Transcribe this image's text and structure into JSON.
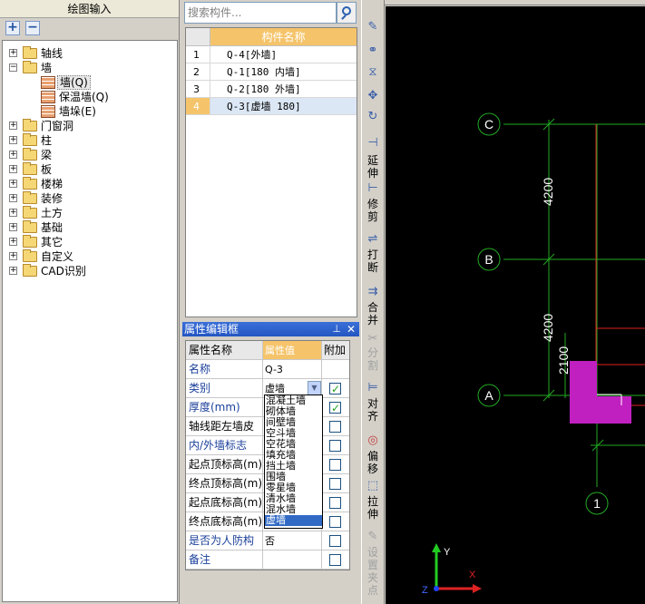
{
  "tree": {
    "title": "绘图输入",
    "items": [
      {
        "label": "轴线"
      },
      {
        "label": "墙"
      },
      {
        "label": "墙(Q)"
      },
      {
        "label": "保温墙(Q)"
      },
      {
        "label": "墙垛(E)"
      },
      {
        "label": "门窗洞"
      },
      {
        "label": "柱"
      },
      {
        "label": "梁"
      },
      {
        "label": "板"
      },
      {
        "label": "楼梯"
      },
      {
        "label": "装修"
      },
      {
        "label": "土方"
      },
      {
        "label": "基础"
      },
      {
        "label": "其它"
      },
      {
        "label": "自定义"
      },
      {
        "label": "CAD识别"
      }
    ]
  },
  "components": {
    "search_placeholder": "搜索构件...",
    "header": "构件名称",
    "rows": [
      {
        "num": "1",
        "name": "Q-4[外墙]"
      },
      {
        "num": "2",
        "name": "Q-1[180 内墙]"
      },
      {
        "num": "3",
        "name": "Q-2[180 外墙]"
      },
      {
        "num": "4",
        "name": "Q-3[虚墙 180]"
      }
    ]
  },
  "properties": {
    "title": "属性编辑框",
    "col_name": "属性名称",
    "col_value": "属性值",
    "col_extra": "附加",
    "rows": [
      {
        "name": "名称",
        "value": "Q-3"
      },
      {
        "name": "类别",
        "value": "虚墙"
      },
      {
        "name": "厚度(mm)",
        "value": ""
      },
      {
        "name": "轴线距左墙皮",
        "value": ""
      },
      {
        "name": "内/外墙标志",
        "value": ""
      },
      {
        "name": "起点顶标高(m)",
        "value": ""
      },
      {
        "name": "终点顶标高(m)",
        "value": ""
      },
      {
        "name": "起点底标高(m)",
        "value": ""
      },
      {
        "name": "终点底标高(m)",
        "value": ""
      },
      {
        "name": "是否为人防构",
        "value": "否"
      },
      {
        "name": "备注",
        "value": ""
      }
    ],
    "category_options": [
      "混凝土墙",
      "砌体墙",
      "间壁墙",
      "空斗墙",
      "空花墙",
      "填充墙",
      "挡土墙",
      "围墙",
      "零星墙",
      "清水墙",
      "混水墙",
      "虚墙"
    ]
  },
  "toolbar": {
    "extend": "延伸",
    "trim": "修剪",
    "break": "打断",
    "merge": "合并",
    "split": "分割",
    "align": "对齐",
    "offset": "偏移",
    "stretch": "拉伸",
    "set_grip": "设置夹点"
  },
  "canvas": {
    "axis_labels": [
      "C",
      "B",
      "A",
      "1"
    ],
    "dims": [
      "4200",
      "4200",
      "2100"
    ],
    "ucs_x": "X",
    "ucs_y": "Y",
    "ucs_z": "Z"
  },
  "colors": {
    "accent_header": "#f5c46a",
    "grid_green": "#22aa22",
    "wall_magenta": "#c020c0",
    "wall_red": "#e02020"
  }
}
